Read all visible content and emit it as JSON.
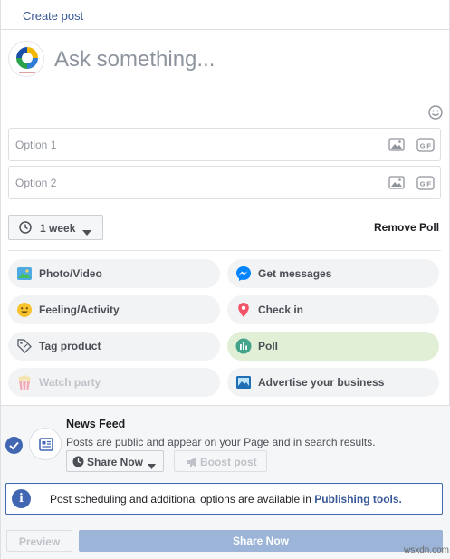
{
  "header": {
    "title": "Create post"
  },
  "composer": {
    "placeholder": "Ask something..."
  },
  "poll": {
    "options": [
      {
        "placeholder": "Option 1"
      },
      {
        "placeholder": "Option 2"
      }
    ],
    "duration": "1 week",
    "remove_label": "Remove Poll"
  },
  "actions": [
    {
      "label": "Photo/Video",
      "icon": "photo-video-icon"
    },
    {
      "label": "Get messages",
      "icon": "messenger-icon"
    },
    {
      "label": "Feeling/Activity",
      "icon": "smiley-icon"
    },
    {
      "label": "Check in",
      "icon": "location-pin-icon"
    },
    {
      "label": "Tag product",
      "icon": "tag-icon"
    },
    {
      "label": "Poll",
      "icon": "poll-icon"
    },
    {
      "label": "Watch party",
      "icon": "popcorn-icon"
    },
    {
      "label": "Advertise your business",
      "icon": "advertise-icon"
    }
  ],
  "news_feed": {
    "title": "News Feed",
    "subtitle": "Posts are public and appear on your Page and in search results.",
    "share_label": "Share Now",
    "boost_label": "Boost post"
  },
  "info": {
    "text": "Post scheduling and additional options are available in",
    "link": "Publishing tools."
  },
  "footer": {
    "preview_label": "Preview",
    "share_label": "Share Now"
  },
  "watermark": "wsxdn.com",
  "colors": {
    "accent": "#4267b2",
    "link": "#385898",
    "poll_active_bg": "#e1efd7",
    "share_disabled": "#9cb4d8"
  }
}
